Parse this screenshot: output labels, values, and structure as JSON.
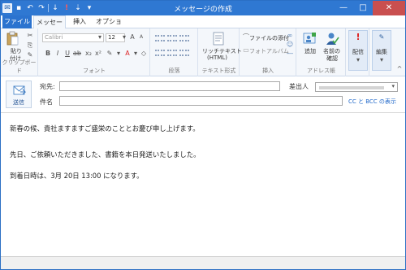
{
  "window": {
    "title": "メッセージの作成"
  },
  "quick_access": {
    "icons": [
      "app-icon",
      "save-icon",
      "undo-icon",
      "redo-icon",
      "priority-low-icon",
      "priority-high-icon",
      "arrow-down-icon",
      "customize-icon"
    ]
  },
  "window_controls": {
    "minimize": "—",
    "maximize": "□",
    "close": "✕"
  },
  "tabs": {
    "file": "ファイル",
    "message": "メッセージ",
    "insert": "挿入",
    "options": "オプション"
  },
  "ribbon": {
    "clipboard": {
      "paste": "貼り",
      "paste2": "付け",
      "label": "クリップボード"
    },
    "font": {
      "family": "Calibri",
      "size": "12",
      "label": "フォント"
    },
    "paragraph": {
      "label": "段落"
    },
    "text_format": {
      "rich_text": "リッチテキスト",
      "rich_text2": "(HTML)",
      "label": "テキスト形式"
    },
    "insert": {
      "attach": "ファイルの添付",
      "photo_album": "フォトアルバム",
      "label": "挿入"
    },
    "address_book": {
      "add": "追加",
      "check": "名前の",
      "check2": "確認",
      "label": "アドレス帳"
    },
    "delivery": {
      "label": "配信"
    },
    "edit": {
      "label": "編集"
    }
  },
  "header": {
    "send": "送信",
    "to_label": "宛先:",
    "subject_label": "件名",
    "from_label": "差出人",
    "cc_bcc": "CC と BCC の表示"
  },
  "body": {
    "line1": "新春の候、貴社ますますご盛栄のこととお慶び申し上げます。",
    "line2": "先日、ご依頼いただきました、書籍を本日発送いたしました。",
    "line3": "到着日時は、3月 20日 13:00 になります。"
  },
  "colors": {
    "accent": "#2f78d2",
    "link": "#1f67c9"
  }
}
